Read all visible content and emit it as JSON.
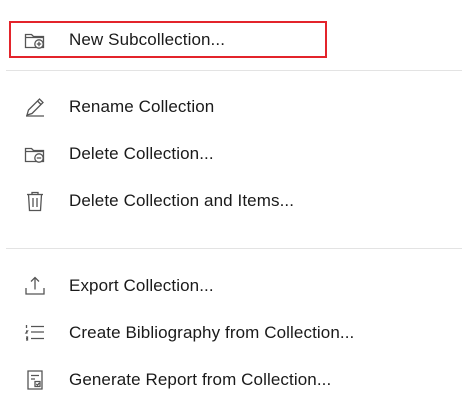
{
  "menu": {
    "items": [
      {
        "label": "New Subcollection...",
        "icon": "folder-add-icon"
      },
      {
        "label": "Rename Collection",
        "icon": "pencil-icon"
      },
      {
        "label": "Delete Collection...",
        "icon": "folder-remove-icon"
      },
      {
        "label": "Delete Collection and Items...",
        "icon": "trash-icon"
      },
      {
        "label": "Export Collection...",
        "icon": "export-icon"
      },
      {
        "label": "Create Bibliography from Collection...",
        "icon": "bibliography-list-icon"
      },
      {
        "label": "Generate Report from Collection...",
        "icon": "report-icon"
      }
    ],
    "highlighted_item": "New Subcollection..."
  },
  "colors": {
    "highlight_border": "#e3242b",
    "separator": "#e3e3e3",
    "text": "#1a1a1a",
    "icon": "#555555"
  }
}
